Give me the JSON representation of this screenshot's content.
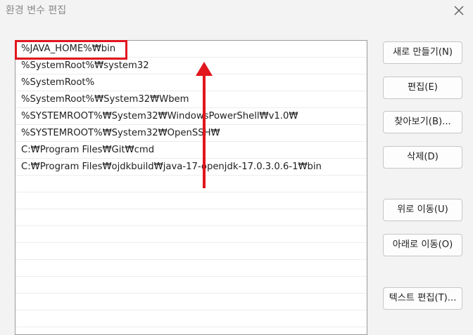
{
  "window": {
    "title": "환경 변수 편집",
    "close_icon": "close-icon"
  },
  "paths": [
    "%JAVA_HOME%₩bin",
    "%SystemRoot%₩system32",
    "%SystemRoot%",
    "%SystemRoot%₩System32₩Wbem",
    "%SYSTEMROOT%₩System32₩WindowsPowerShell₩v1.0₩",
    "%SYSTEMROOT%₩System32₩OpenSSH₩",
    "C:₩Program Files₩Git₩cmd",
    "C:₩Program Files₩ojdkbuild₩java-17-openjdk-17.0.3.0.6-1₩bin",
    "",
    "",
    "",
    "",
    "",
    "",
    "",
    "",
    ""
  ],
  "selected_index": 0,
  "buttons": {
    "new": "새로 만들기(N)",
    "edit": "편집(E)",
    "browse": "찾아보기(B)...",
    "delete": "삭제(D)",
    "move_up": "위로 이동(U)",
    "move_down": "아래로 이동(O)",
    "edit_text": "텍스트 편집(T)..."
  },
  "colors": {
    "highlight": "#e2161d",
    "background": "#f3f3f3"
  }
}
